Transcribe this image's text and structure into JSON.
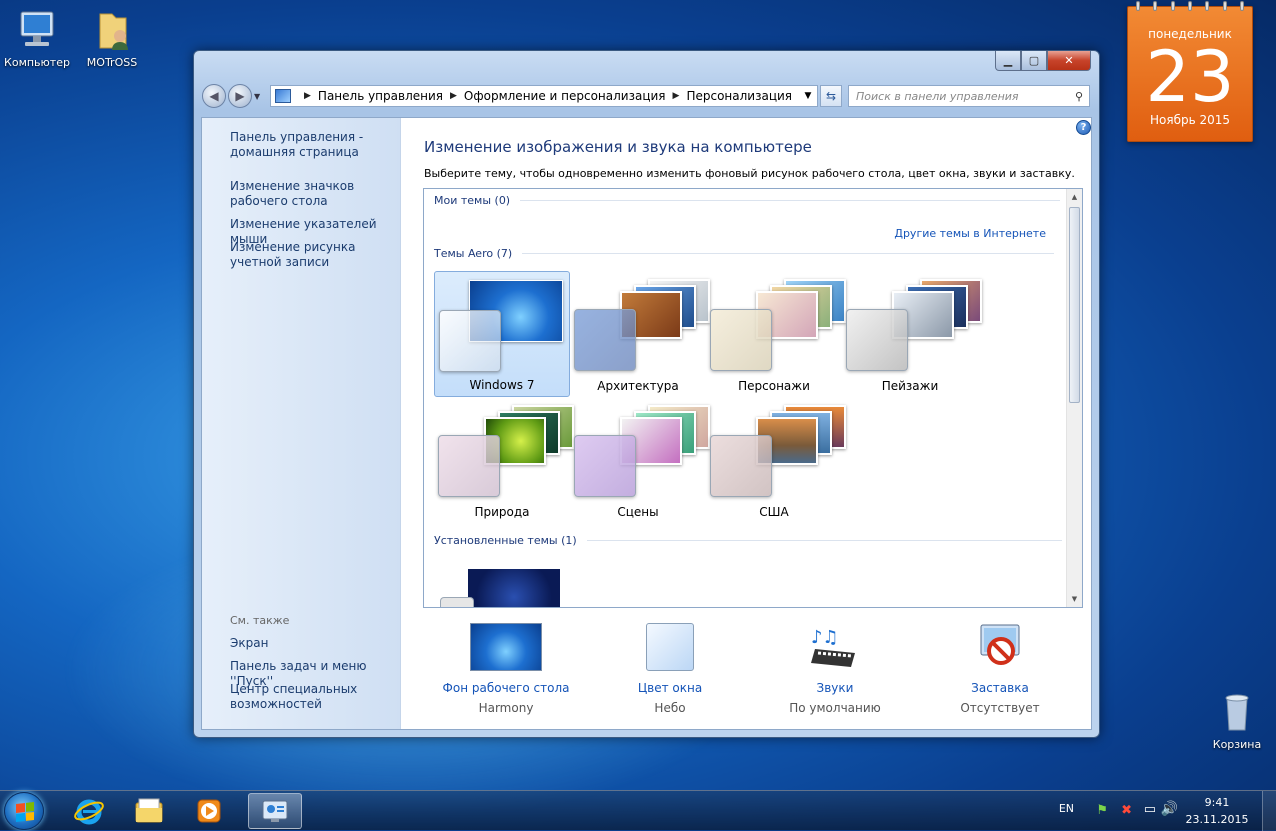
{
  "desktop": {
    "icons": [
      {
        "label": "Компьютер"
      },
      {
        "label": "MOTrOSS"
      },
      {
        "label": "Корзина"
      }
    ]
  },
  "gadget": {
    "weekday": "понедельник",
    "day": "23",
    "month_year": "Ноябрь 2015"
  },
  "window": {
    "address": [
      "Панель управления",
      "Оформление и персонализация",
      "Персонализация"
    ],
    "search_placeholder": "Поиск в панели управления",
    "sidebar": {
      "links": [
        "Панель управления - домашняя страница",
        "Изменение значков рабочего стола",
        "Изменение указателей мыши",
        "Изменение рисунка учетной записи"
      ],
      "see_also": "См. также",
      "see_also_links": [
        "Экран",
        "Панель задач и меню ''Пуск''",
        "Центр специальных возможностей"
      ]
    },
    "title": "Изменение изображения и звука на компьютере",
    "subtitle": "Выберите тему, чтобы одновременно изменить фоновый рисунок рабочего стола, цвет окна, звуки и заставку.",
    "groups": {
      "my": "Мои темы (0)",
      "more_online": "Другие темы в Интернете",
      "aero": "Темы Aero (7)",
      "installed": "Установленные темы (1)"
    },
    "themes": [
      {
        "label": "Windows 7",
        "selected": true
      },
      {
        "label": "Архитектура"
      },
      {
        "label": "Персонажи"
      },
      {
        "label": "Пейзажи"
      },
      {
        "label": "Природа"
      },
      {
        "label": "Сцены"
      },
      {
        "label": "США"
      }
    ],
    "bottom": [
      {
        "title": "Фон рабочего стола",
        "value": "Harmony"
      },
      {
        "title": "Цвет окна",
        "value": "Небо"
      },
      {
        "title": "Звуки",
        "value": "По умолчанию"
      },
      {
        "title": "Заставка",
        "value": "Отсутствует"
      }
    ]
  },
  "tray": {
    "lang": "EN",
    "time": "9:41",
    "date": "23.11.2015"
  }
}
